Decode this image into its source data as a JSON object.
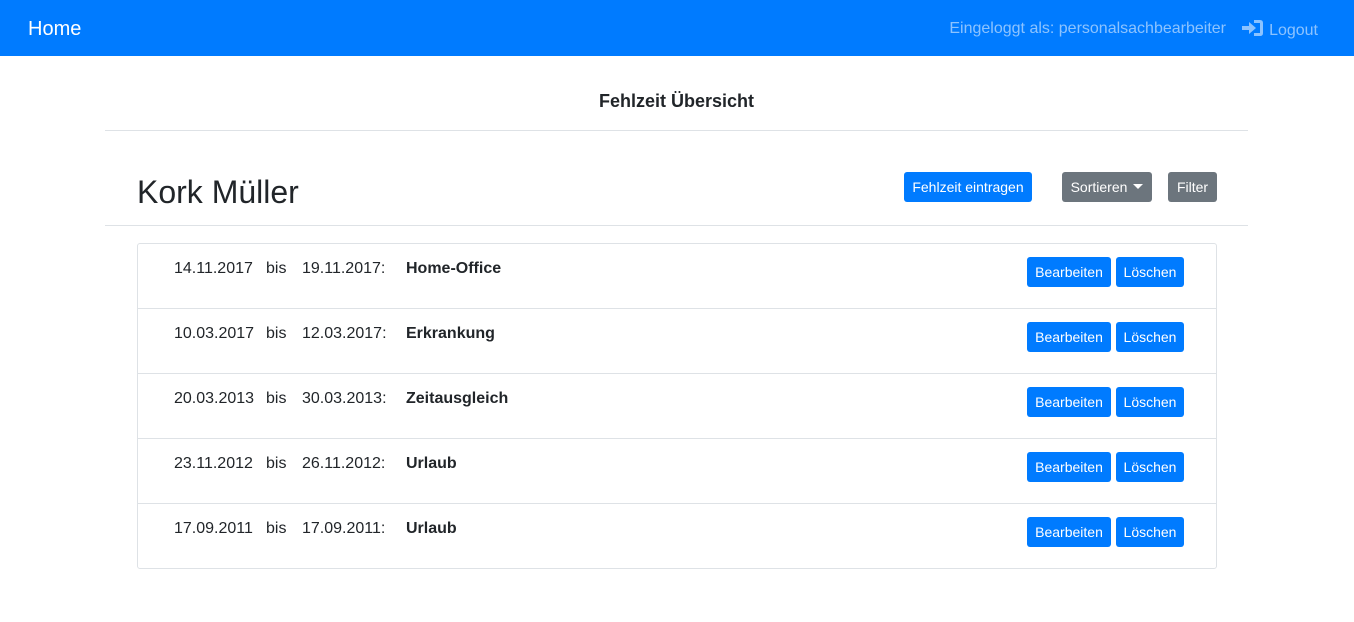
{
  "navbar": {
    "brand": "Home",
    "user_text": "Eingeloggt als: personalsachbearbeiter",
    "logout_label": "Logout",
    "color": "#007bff"
  },
  "page": {
    "title": "Fehlzeit Übersicht"
  },
  "employee": {
    "name": "Kork Müller"
  },
  "toolbar": {
    "new_label": "Fehlzeit eintragen",
    "sort_label": "Sortieren",
    "filter_label": "Filter"
  },
  "absences": [
    {
      "from": "14.11.2017",
      "separator": "bis",
      "to": "19.11.2017:",
      "type": "Home-Office",
      "edit_label": "Bearbeiten",
      "delete_label": "Löschen"
    },
    {
      "from": "10.03.2017",
      "separator": "bis",
      "to": "12.03.2017:",
      "type": "Erkrankung",
      "edit_label": "Bearbeiten",
      "delete_label": "Löschen"
    },
    {
      "from": "20.03.2013",
      "separator": "bis",
      "to": "30.03.2013:",
      "type": "Zeitausgleich",
      "edit_label": "Bearbeiten",
      "delete_label": "Löschen"
    },
    {
      "from": "23.11.2012",
      "separator": "bis",
      "to": "26.11.2012:",
      "type": "Urlaub",
      "edit_label": "Bearbeiten",
      "delete_label": "Löschen"
    },
    {
      "from": "17.09.2011",
      "separator": "bis",
      "to": "17.09.2011:",
      "type": "Urlaub",
      "edit_label": "Bearbeiten",
      "delete_label": "Löschen"
    }
  ]
}
